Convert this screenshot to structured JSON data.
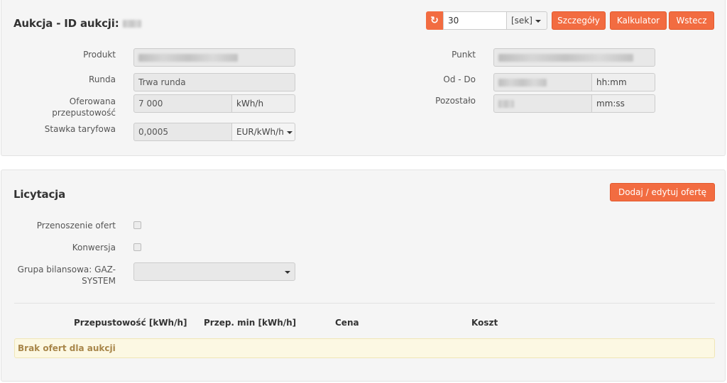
{
  "auction": {
    "title": "Aukcja - ID aukcji:",
    "refresh_value": "30",
    "refresh_unit": "[sek]",
    "buttons": {
      "details": "Szczegóły",
      "calculator": "Kalkulator",
      "back": "Wstecz"
    },
    "fields": {
      "product_label": "Produkt",
      "round_label": "Runda",
      "round_value": "Trwa runda",
      "capacity_label": "Oferowana przepustowość",
      "capacity_value": "7 000",
      "capacity_unit": "kWh/h",
      "rate_label": "Stawka taryfowa",
      "rate_value": "0,0005",
      "rate_unit": "EUR/kWh/h",
      "point_label": "Punkt",
      "from_to_label": "Od - Do",
      "from_to_unit": "hh:mm",
      "remaining_label": "Pozostało",
      "remaining_unit": "mm:ss"
    }
  },
  "bidding": {
    "title": "Licytacja",
    "add_edit_button": "Dodaj / edytuj ofertę",
    "transfer_label": "Przenoszenie ofert",
    "conversion_label": "Konwersja",
    "balance_group_label": "Grupa bilansowa: GAZ-SYSTEM",
    "table": {
      "headers": [
        "Przepustowość [kWh/h]",
        "Przep. min [kWh/h]",
        "Cena",
        "Koszt"
      ],
      "empty_message": "Brak ofert dla aukcji"
    }
  },
  "colors": {
    "accent": "#f26c41",
    "alert_bg": "#fcf8e3",
    "alert_text": "#a8864a"
  }
}
